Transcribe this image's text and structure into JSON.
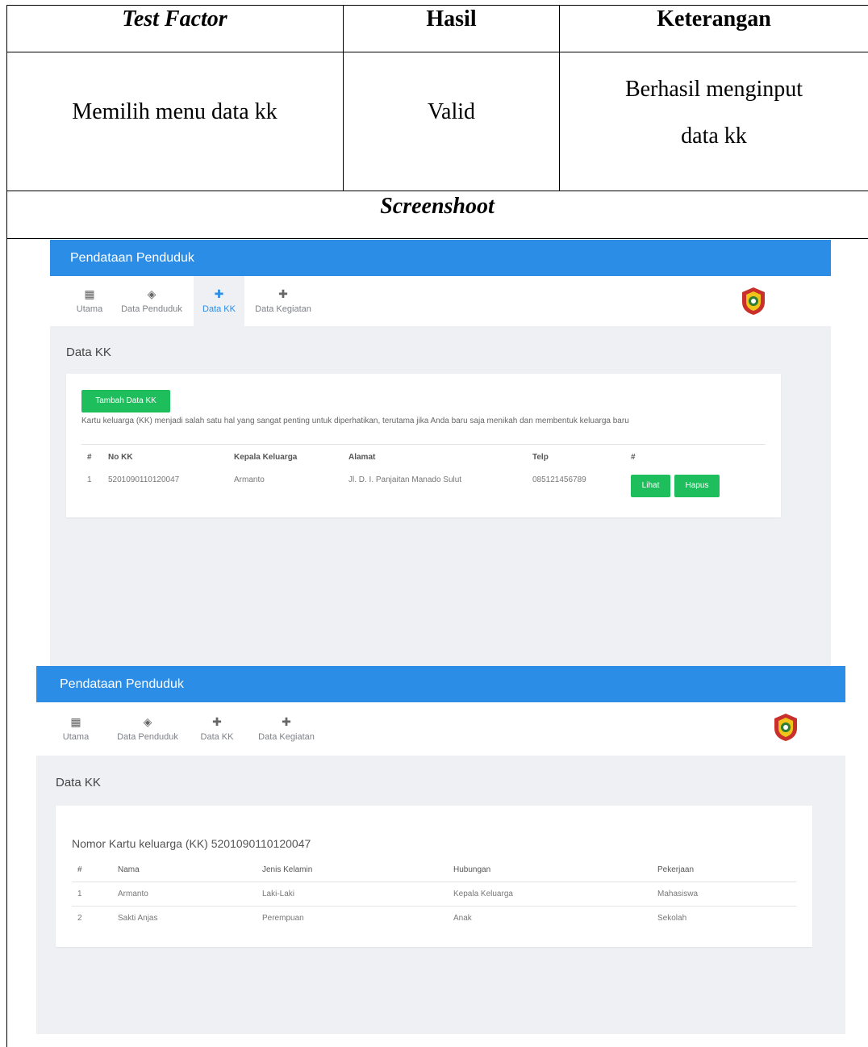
{
  "table": {
    "headers": {
      "test_factor": "Test Factor",
      "hasil": "Hasil",
      "keterangan": "Keterangan"
    },
    "row": {
      "test_factor": "Memilih menu data kk",
      "hasil": "Valid",
      "keterangan_line1": "Berhasil menginput",
      "keterangan_line2": "data kk"
    },
    "screenshot_label": "Screenshoot"
  },
  "shot1": {
    "app_title": "Pendataan Penduduk",
    "nav": [
      {
        "label": "Utama",
        "icon": "grid-icon"
      },
      {
        "label": "Data Penduduk",
        "icon": "layers-icon"
      },
      {
        "label": "Data KK",
        "icon": "puzzle-icon"
      },
      {
        "label": "Data Kegiatan",
        "icon": "puzzle-icon"
      }
    ],
    "active_nav": "Data KK",
    "page_title": "Data KK",
    "add_button": "Tambah Data KK",
    "description": "Kartu keluarga (KK) menjadi salah satu hal yang sangat penting untuk diperhatikan, terutama jika Anda baru saja menikah dan membentuk keluarga baru",
    "columns": [
      "#",
      "No KK",
      "Kepala Keluarga",
      "Alamat",
      "Telp",
      "#"
    ],
    "rows": [
      {
        "no": "1",
        "no_kk": "5201090110120047",
        "kepala": "Armanto",
        "alamat": "Jl. D. I. Panjaitan Manado Sulut",
        "telp": "085121456789"
      }
    ],
    "btn_view": "Lihat",
    "btn_delete": "Hapus"
  },
  "shot2": {
    "app_title": "Pendataan Penduduk",
    "nav": [
      {
        "label": "Utama",
        "icon": "grid-icon"
      },
      {
        "label": "Data Penduduk",
        "icon": "layers-icon"
      },
      {
        "label": "Data KK",
        "icon": "puzzle-icon"
      },
      {
        "label": "Data Kegiatan",
        "icon": "puzzle-icon"
      }
    ],
    "page_title": "Data KK",
    "heading": "Nomor Kartu keluarga (KK) 5201090110120047",
    "columns": [
      "#",
      "Nama",
      "Jenis Kelamin",
      "Hubungan",
      "Pekerjaan"
    ],
    "rows": [
      {
        "no": "1",
        "nama": "Armanto",
        "jk": "Laki-Laki",
        "hubungan": "Kepala Keluarga",
        "pekerjaan": "Mahasiswa"
      },
      {
        "no": "2",
        "nama": "Sakti Anjas",
        "jk": "Perempuan",
        "hubungan": "Anak",
        "pekerjaan": "Sekolah"
      }
    ]
  },
  "colors": {
    "header_blue": "#2c8de6",
    "button_green": "#1fbe5c",
    "page_bg": "#eef0f4"
  }
}
